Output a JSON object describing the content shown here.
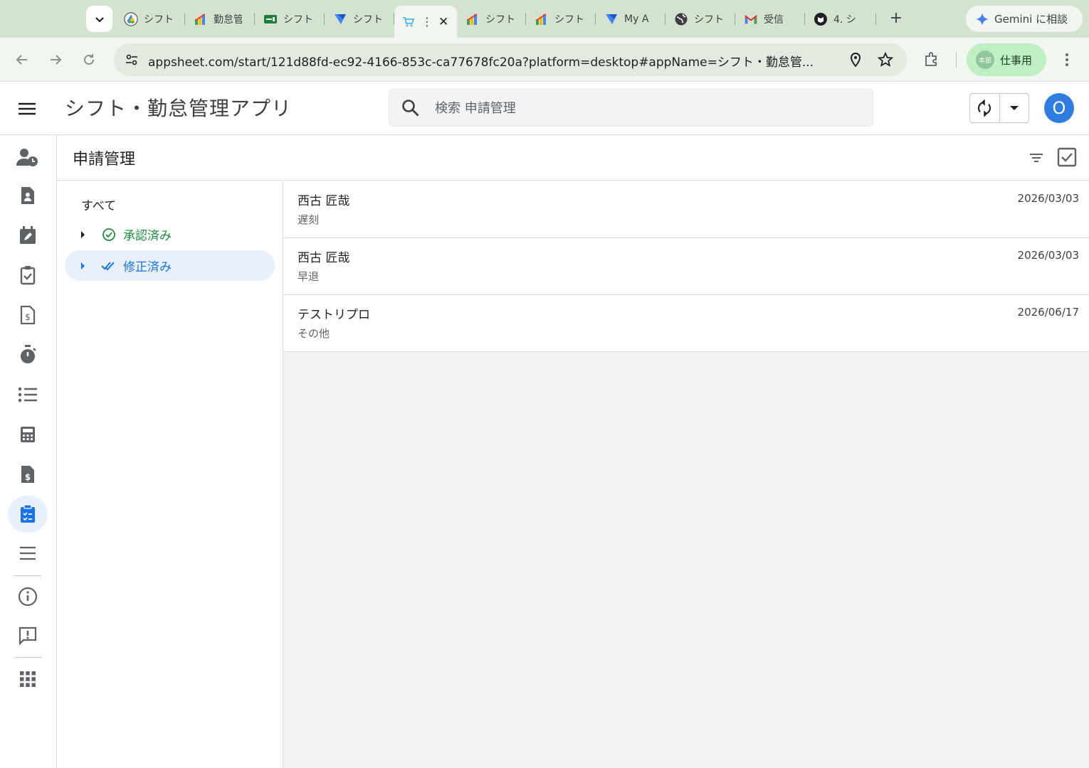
{
  "browser": {
    "tabs": [
      {
        "label": "シフト",
        "icon": "google-drive-icon"
      },
      {
        "label": "勤怠管",
        "icon": "appsheet-icon"
      },
      {
        "label": "シフト",
        "icon": "sheets-icon"
      },
      {
        "label": "シフト",
        "icon": "forms-icon"
      },
      {
        "label": "",
        "icon": "cart-icon",
        "active": true
      },
      {
        "label": "シフト",
        "icon": "appsheet-icon"
      },
      {
        "label": "シフト",
        "icon": "appsheet-icon"
      },
      {
        "label": "My A",
        "icon": "forms-icon"
      },
      {
        "label": "シフト",
        "icon": "globe-icon"
      },
      {
        "label": "受信",
        "icon": "gmail-icon"
      },
      {
        "label": "4. シ",
        "icon": "notion-icon"
      }
    ],
    "gemini_label": "Gemini に相談",
    "url": "appsheet.com/start/121d88fd-ec92-4166-853c-ca77678fc20a?platform=desktop#appName=シフト・勤怠管...",
    "profile_label": "仕事用",
    "profile_badge": "本部"
  },
  "app": {
    "title": "シフト・勤怠管理アプリ",
    "search_placeholder": "検索 申請管理",
    "user_initial": "O",
    "accent_color": "#2f7de1"
  },
  "page": {
    "title": "申請管理",
    "groups": {
      "all_label": "すべて",
      "items": [
        {
          "label": "承認済み",
          "color": "#1e8e3e"
        },
        {
          "label": "修正済み",
          "color": "#1a73e8",
          "selected": true
        }
      ]
    },
    "rows": [
      {
        "name": "西古 匠哉",
        "type": "遅刻",
        "date": "2026/03/03"
      },
      {
        "name": "西古 匠哉",
        "type": "早退",
        "date": "2026/03/03"
      },
      {
        "name": "テストリプロ",
        "type": "その他",
        "date": "2026/06/17"
      }
    ]
  }
}
